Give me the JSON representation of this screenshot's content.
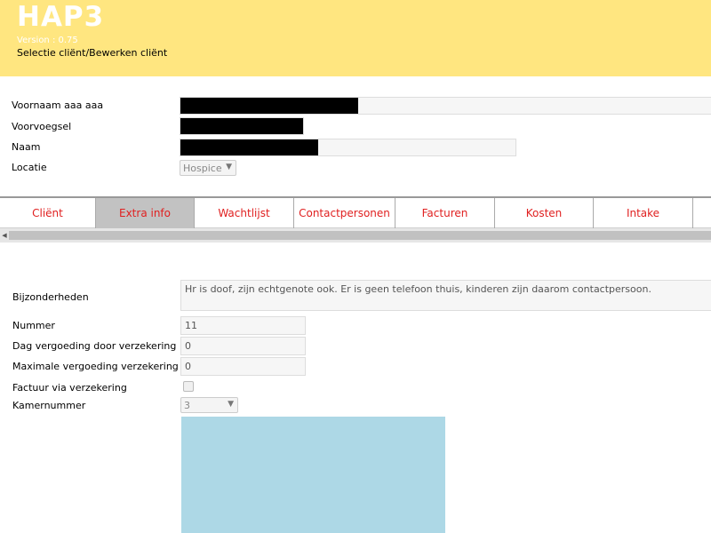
{
  "header": {
    "app_title": "HAP3",
    "version": "Version : 0.75",
    "subtitle": "Selectie cliënt/Bewerken cliënt"
  },
  "client_form": {
    "voornaam_label": "Voornaam aaa aaa",
    "voorvoegsel_label": "Voorvoegsel",
    "naam_label": "Naam",
    "locatie_label": "Locatie",
    "locatie_value": "Hospice"
  },
  "tabs": [
    {
      "label": "Cliënt"
    },
    {
      "label": "Extra info",
      "active": true
    },
    {
      "label": "Wachtlijst"
    },
    {
      "label": "Contactpersonen"
    },
    {
      "label": "Facturen"
    },
    {
      "label": "Kosten"
    },
    {
      "label": "Intake"
    }
  ],
  "extra_info": {
    "bijzonderheden_label": "Bijzonderheden",
    "bijzonderheden_value": "Hr is doof, zijn echtgenote ook. Er is geen telefoon thuis, kinderen zijn daarom contactpersoon.",
    "nummer_label": "Nummer",
    "nummer_value": "11",
    "dag_vergoeding_label": "Dag vergoeding door verzekering",
    "dag_vergoeding_value": "0",
    "max_vergoeding_label": "Maximale vergoeding verzekering",
    "max_vergoeding_value": "0",
    "factuur_label": "Factuur via verzekering",
    "factuur_checked": false,
    "kamernummer_label": "Kamernummer",
    "kamernummer_value": "3"
  },
  "colors": {
    "header_bg": "#ffe680",
    "tab_text": "#e02020",
    "active_tab_bg": "#c2c2c2",
    "panel_bg": "#add8e6"
  }
}
